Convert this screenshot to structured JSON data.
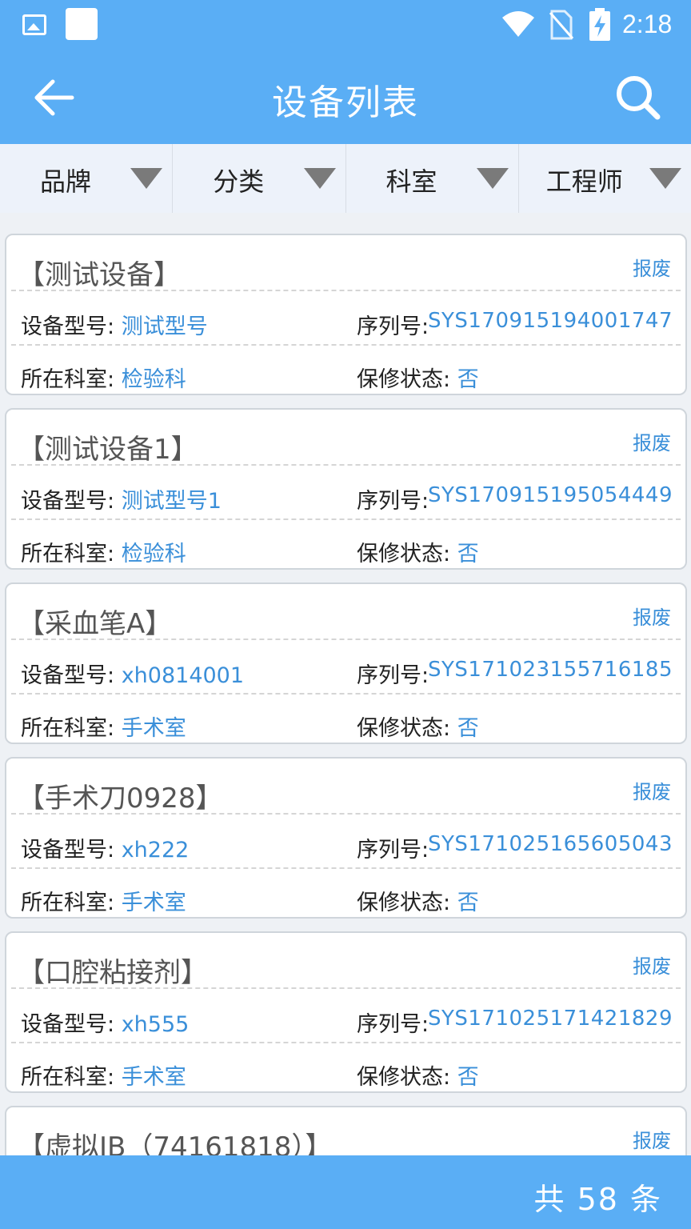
{
  "status_bar": {
    "time": "2:18",
    "icons": [
      "image-icon",
      "app-square-icon",
      "wifi-icon",
      "no-sim-icon",
      "battery-charging-icon"
    ]
  },
  "app_bar": {
    "title": "设备列表",
    "back_icon": "arrow-left-icon",
    "search_icon": "search-icon"
  },
  "filters": [
    {
      "label": "品牌"
    },
    {
      "label": "分类"
    },
    {
      "label": "科室"
    },
    {
      "label": "工程师"
    }
  ],
  "labels": {
    "model": "设备型号:",
    "serial": "序列号:",
    "dept": "所在科室:",
    "warranty": "保修状态:",
    "scrap": "报废"
  },
  "devices": [
    {
      "name": "【测试设备】",
      "model": "测试型号",
      "serial": "SYS170915194001747",
      "dept": "检验科",
      "warranty": "否"
    },
    {
      "name": "【测试设备1】",
      "model": "测试型号1",
      "serial": "SYS170915195054449",
      "dept": "检验科",
      "warranty": "否"
    },
    {
      "name": "【采血笔A】",
      "model": "xh0814001",
      "serial": "SYS171023155716185",
      "dept": "手术室",
      "warranty": "否"
    },
    {
      "name": "【手术刀0928】",
      "model": "xh222",
      "serial": "SYS171025165605043",
      "dept": "手术室",
      "warranty": "否"
    },
    {
      "name": "【口腔粘接剂】",
      "model": "xh555",
      "serial": "SYS171025171421829",
      "dept": "手术室",
      "warranty": "否"
    },
    {
      "name": "【虚拟IB（74161818）】"
    }
  ],
  "footer": {
    "count_text": "共 58 条"
  },
  "colors": {
    "primary": "#5aaef5",
    "link": "#3a8fd9",
    "text": "#222222",
    "title_gray": "#555555"
  }
}
